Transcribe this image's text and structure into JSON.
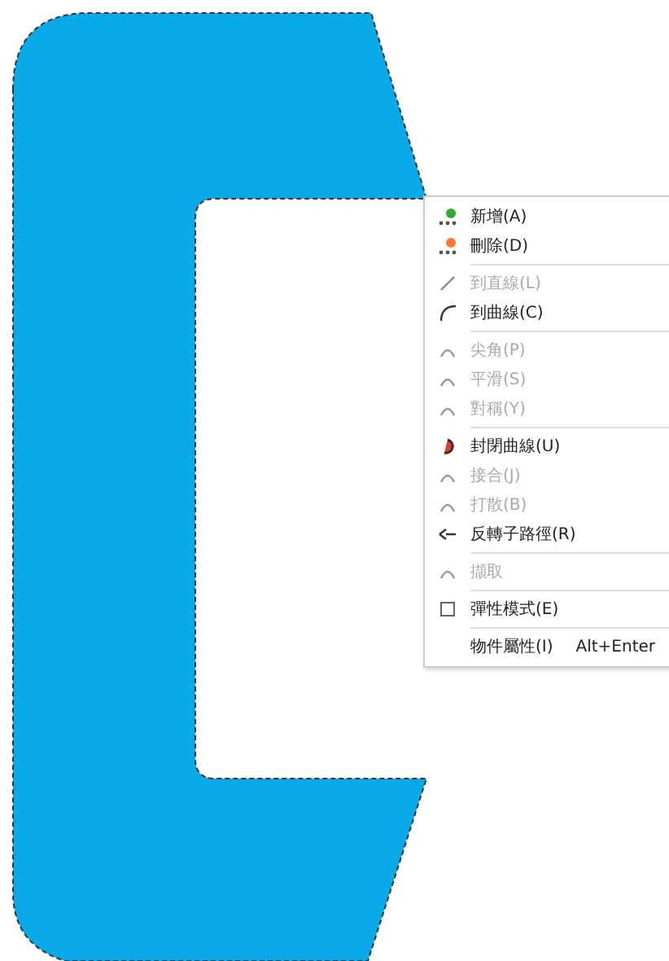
{
  "context_menu": {
    "items": [
      {
        "kind": "item",
        "label": "新增(A)",
        "disabled": false
      },
      {
        "kind": "item",
        "label": "刪除(D)",
        "disabled": false
      },
      {
        "kind": "separator"
      },
      {
        "kind": "item",
        "label": "到直線(L)",
        "disabled": true
      },
      {
        "kind": "item",
        "label": "到曲線(C)",
        "disabled": false
      },
      {
        "kind": "separator"
      },
      {
        "kind": "item",
        "label": "尖角(P)",
        "disabled": true
      },
      {
        "kind": "item",
        "label": "平滑(S)",
        "disabled": true
      },
      {
        "kind": "item",
        "label": "對稱(Y)",
        "disabled": true
      },
      {
        "kind": "separator"
      },
      {
        "kind": "item",
        "label": "封閉曲線(U)",
        "disabled": false
      },
      {
        "kind": "item",
        "label": "接合(J)",
        "disabled": true
      },
      {
        "kind": "item",
        "label": "打散(B)",
        "disabled": true
      },
      {
        "kind": "item",
        "label": "反轉子路徑(R)",
        "disabled": false
      },
      {
        "kind": "separator"
      },
      {
        "kind": "item",
        "label": "擷取",
        "disabled": true
      },
      {
        "kind": "separator"
      },
      {
        "kind": "item",
        "label": "彈性模式(E)",
        "disabled": false
      },
      {
        "kind": "separator"
      },
      {
        "kind": "item",
        "label": "物件屬性(I)",
        "shortcut": "Alt+Enter",
        "disabled": false
      }
    ]
  }
}
